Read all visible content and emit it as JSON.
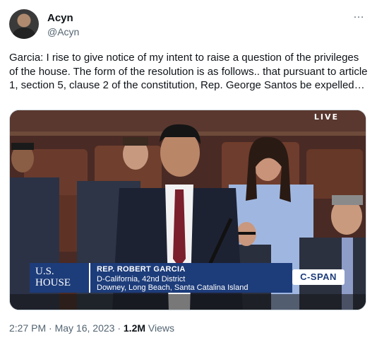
{
  "author": {
    "name": "Acyn",
    "handle": "@Acyn",
    "avatar_icon": "profile-photo"
  },
  "more_icon": "…",
  "tweet_text": "Garcia: I rise to give notice of my intent to raise a question of the privileges of the house. The form of the resolution is as follows.. that pursuant to article 1, section 5, clause 2 of the constitution, Rep. George Santos be expelled…",
  "video": {
    "live_label": "LIVE",
    "house_logo_line1": "U.S.",
    "house_logo_line2": "HOUSE",
    "speaker_name": "REP. ROBERT GARCIA",
    "speaker_line1": "D-California, 42nd District",
    "speaker_line2": "Downey, Long Beach, Santa Catalina Island",
    "network": "C-SPAN"
  },
  "meta": {
    "time": "2:27 PM",
    "separator": " · ",
    "date": "May 16, 2023",
    "views_count": "1.2M",
    "views_label": " Views"
  },
  "colors": {
    "text_primary": "#0f1419",
    "text_secondary": "#536471",
    "lower_third": "#1d3c7a"
  }
}
